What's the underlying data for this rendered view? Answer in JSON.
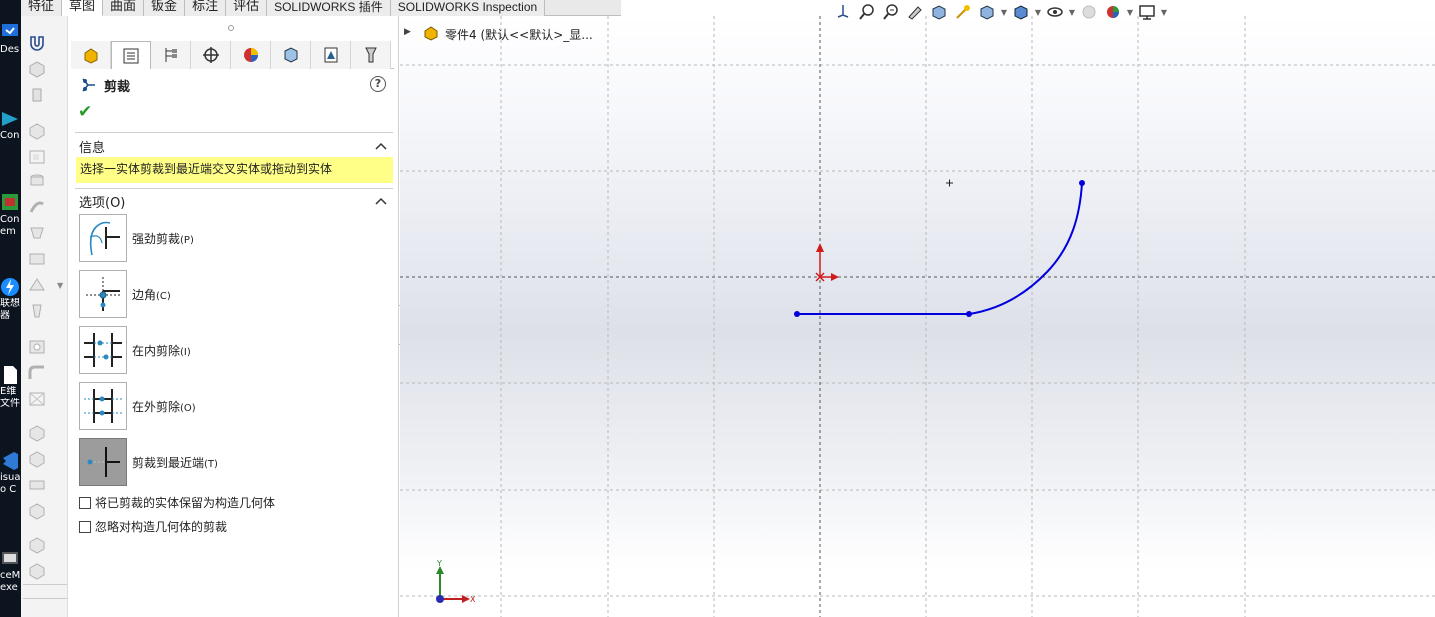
{
  "desktop": {
    "items": [
      {
        "label": "Des",
        "color": "#1e6fd9"
      },
      {
        "label": "Con",
        "color": "#22a0c8"
      },
      {
        "label": "Con",
        "label2": "em",
        "color": "#c03030"
      },
      {
        "label": "联想",
        "label2": "器",
        "color": "#1a8cff"
      },
      {
        "label": "E维",
        "label2": "文件",
        "color": "#ffffff"
      },
      {
        "label": "isua",
        "label2": "o C",
        "color": "#2f7ad6"
      },
      {
        "label": "ceM",
        "label2": "exe",
        "color": "#555555"
      }
    ]
  },
  "tabs": [
    {
      "label": "特征"
    },
    {
      "label": "草图",
      "active": true
    },
    {
      "label": "曲面"
    },
    {
      "label": "钣金"
    },
    {
      "label": "标注"
    },
    {
      "label": "评估"
    },
    {
      "label": "SOLIDWORKS 插件"
    },
    {
      "label": "SOLIDWORKS Inspection"
    }
  ],
  "property_manager": {
    "title": "剪裁",
    "help": "?",
    "info_section_title": "信息",
    "info_message": "选择一实体剪裁到最近端交叉实体或拖动到实体",
    "options_section_title": "选项(O)",
    "options": [
      {
        "label": "强劲剪裁",
        "hotkey": "(P)"
      },
      {
        "label": "边角",
        "hotkey": "(C)"
      },
      {
        "label": "在内剪除",
        "hotkey": "(I)"
      },
      {
        "label": "在外剪除",
        "hotkey": "(O)"
      },
      {
        "label": "剪裁到最近端",
        "hotkey": "(T)",
        "selected": true
      }
    ],
    "checkboxes": [
      {
        "label": "将已剪裁的实体保留为构造几何体",
        "checked": false
      },
      {
        "label": "忽略对构造几何体的剪裁",
        "checked": false
      }
    ]
  },
  "feature_tree": {
    "item_label": "零件4  (默认<<默认>_显..."
  },
  "triad": {
    "x_label": "X",
    "y_label": "Y"
  },
  "colors": {
    "sketch_line": "#0000dd",
    "origin": "#d11a1a",
    "info_bg": "#ffff88",
    "check": "#2a9a2a"
  }
}
